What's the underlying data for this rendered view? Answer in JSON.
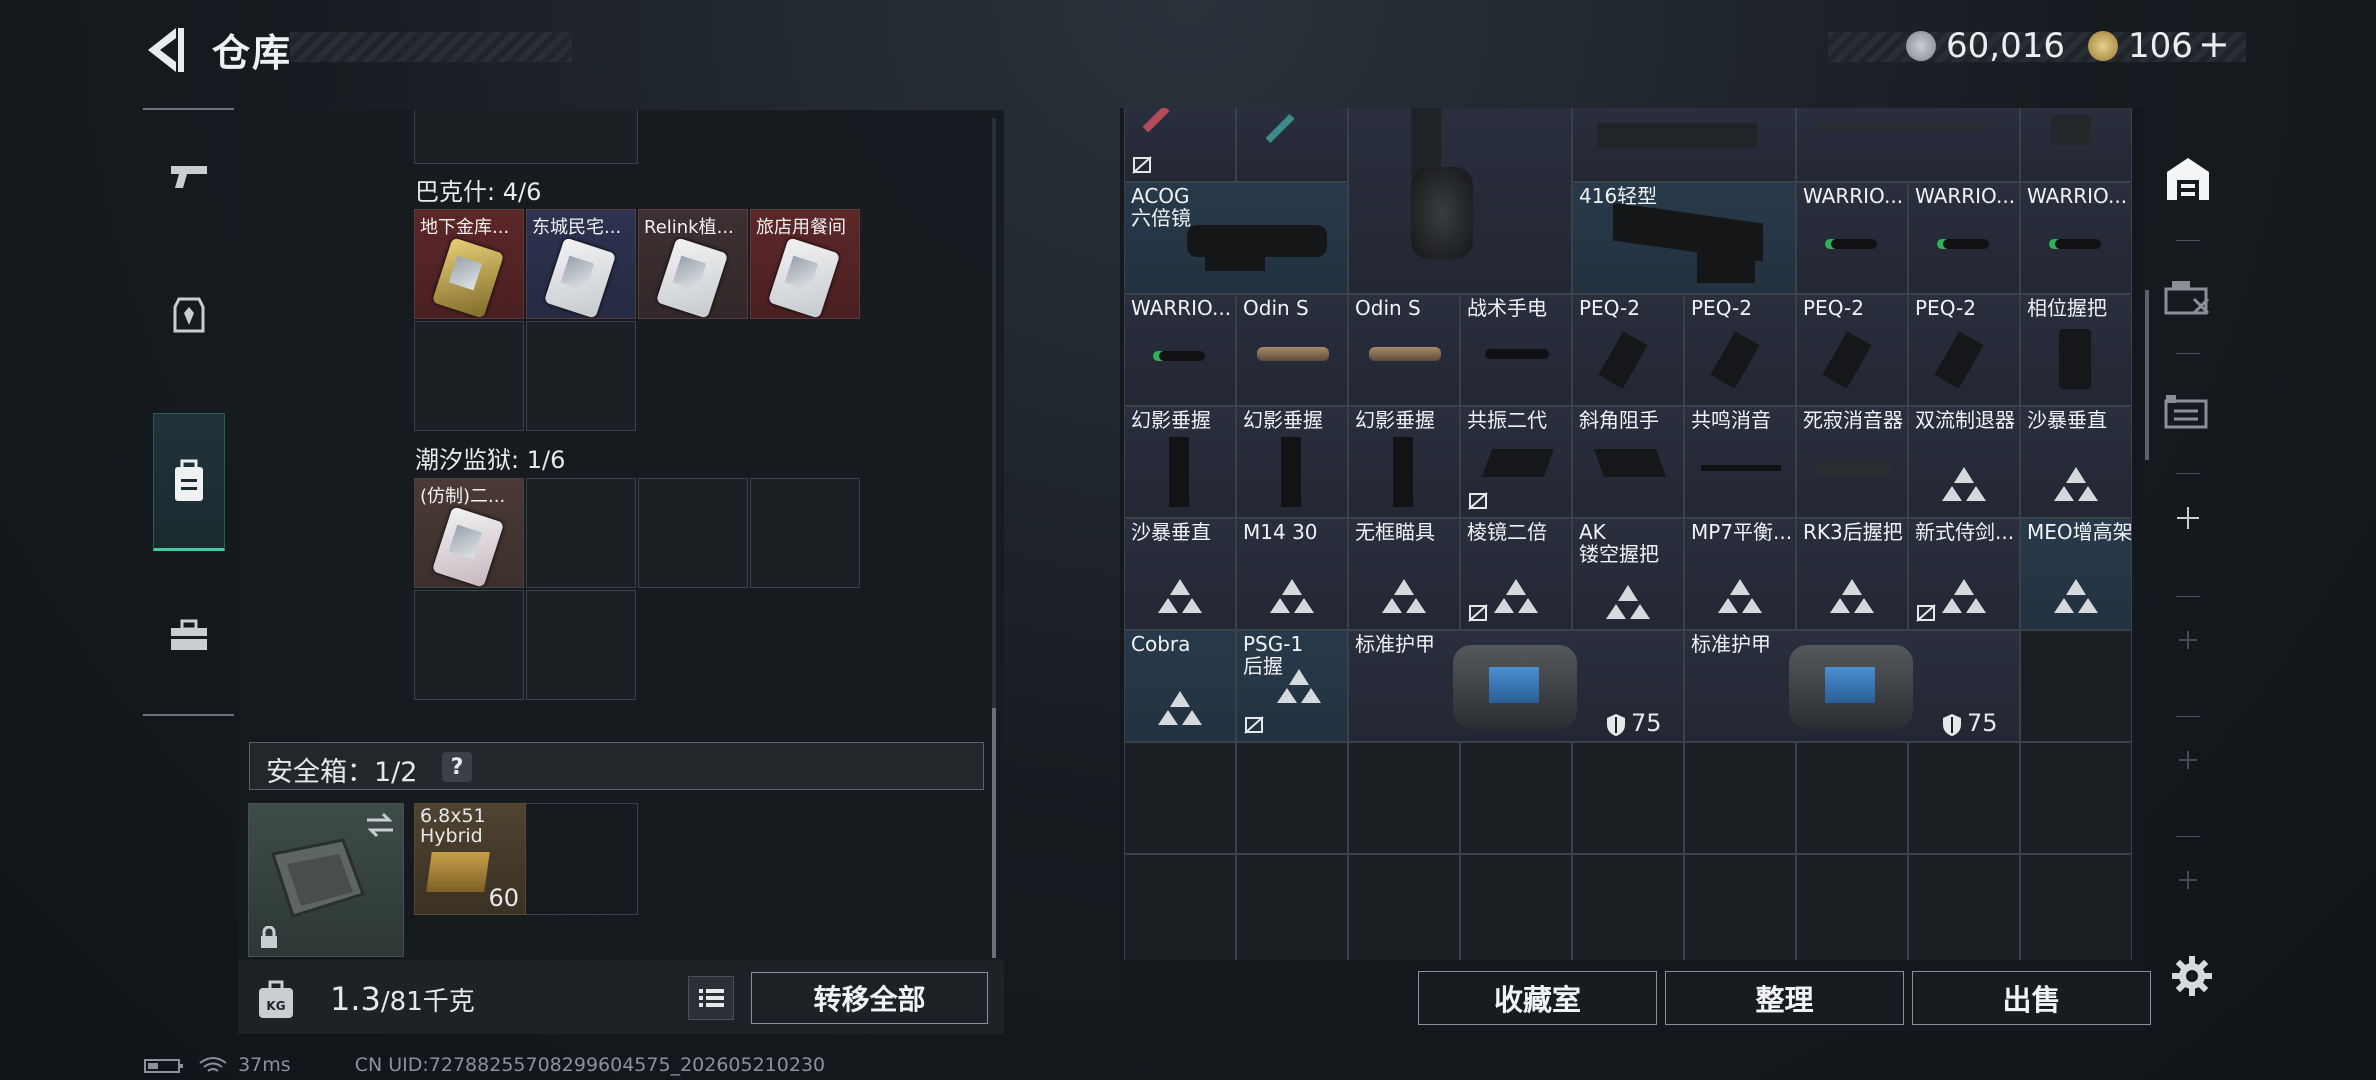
{
  "header": {
    "title": "仓库",
    "silver": "60,016",
    "gold": "106",
    "gold_plus": "+"
  },
  "left": {
    "section1": {
      "label": "巴克什: 4/6",
      "cards": [
        "地下金库...",
        "东城民宅...",
        "Relink植...",
        "旅店用餐间"
      ]
    },
    "section2": {
      "label": "潮汐监狱: 1/6",
      "cards": [
        "(仿制)二..."
      ]
    },
    "safe": {
      "label": "安全箱：1/2",
      "help": "?"
    },
    "ammo": {
      "name_line1": "6.8x51",
      "name_line2": "Hybrid",
      "count": "60"
    },
    "weight": {
      "current": "1.3",
      "max": "/81千克"
    },
    "transfer_label": "转移全部"
  },
  "grid": {
    "row1": [
      {
        "name": "ACOG",
        "sub": "六倍镜"
      },
      {
        "name": "416轻型"
      },
      {
        "name": "WARRIO..."
      },
      {
        "name": "WARRIO..."
      },
      {
        "name": "WARRIO..."
      }
    ],
    "row2": [
      "WARRIO...",
      "Odin S",
      "Odin S",
      "战术手电",
      "PEQ-2",
      "PEQ-2",
      "PEQ-2",
      "PEQ-2",
      "相位握把"
    ],
    "row3": [
      "幻影垂握",
      "幻影垂握",
      "幻影垂握",
      "共振二代",
      "斜角阻手",
      "共鸣消音",
      "死寂消音器",
      "双流制退器",
      "沙暴垂直"
    ],
    "row4": [
      {
        "name": "沙暴垂直"
      },
      {
        "name": "M14 30"
      },
      {
        "name": "无框瞄具"
      },
      {
        "name": "棱镜二倍"
      },
      {
        "name": "AK",
        "sub": "镂空握把"
      },
      {
        "name": "MP7平衡..."
      },
      {
        "name": "RK3后握把"
      },
      {
        "name": "新式侍剑..."
      },
      {
        "name": "MEO增高架"
      }
    ],
    "row5": [
      {
        "name": "Cobra"
      },
      {
        "name": "PSG-1",
        "sub": "后握"
      },
      {
        "name": "标准护甲",
        "armor": "75"
      },
      {
        "name": "标准护甲",
        "armor": "75"
      }
    ]
  },
  "buttons": {
    "collection": "收藏室",
    "sort": "整理",
    "sell": "出售"
  },
  "status": {
    "ping": "37ms",
    "uid": "CN UID:72788255708299604575_202605210230"
  },
  "colors": {
    "accent": "#3fcca5",
    "card_red": "#5a2628",
    "card_blue": "#2a3148"
  }
}
